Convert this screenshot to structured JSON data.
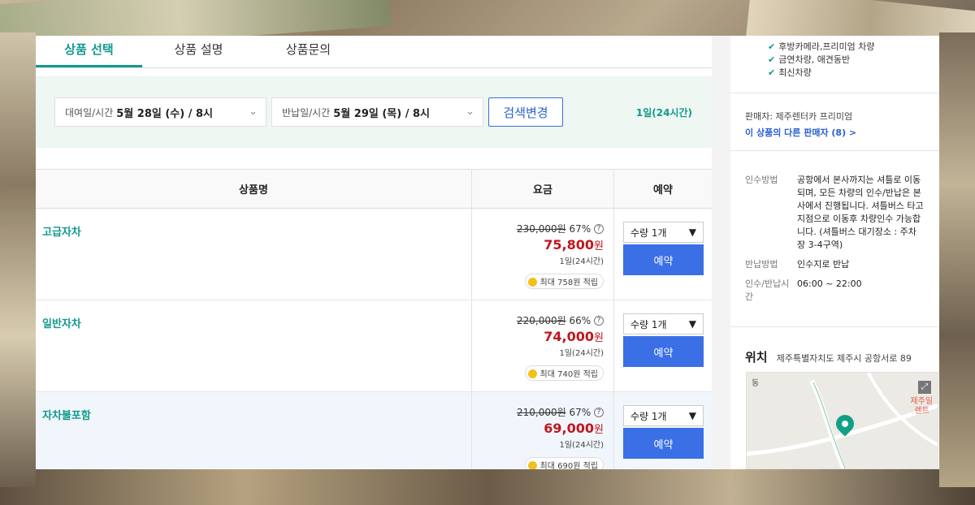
{
  "tabs": [
    "상품 선택",
    "상품 설명",
    "상품문의"
  ],
  "search": {
    "rental_label": "대여일/시간",
    "rental_value": "5월 28일 (수) / 8시",
    "return_label": "반납일/시간",
    "return_value": "5월 29일 (목) / 8시",
    "button": "검색변경",
    "duration": "1일(24시간)"
  },
  "table": {
    "headers": [
      "상품명",
      "요금",
      "예약"
    ],
    "rows": [
      {
        "name": "고급자차",
        "orig": "230,000원",
        "disc": "67%",
        "price": "75,800",
        "unit": "원",
        "per": "1일(24시간)",
        "points": "최대 758원 적립",
        "qty": "수량 1개",
        "reserve": "예약"
      },
      {
        "name": "일반자차",
        "orig": "220,000원",
        "disc": "66%",
        "price": "74,000",
        "unit": "원",
        "per": "1일(24시간)",
        "points": "최대 740원 적립",
        "qty": "수량 1개",
        "reserve": "예약"
      },
      {
        "name": "자차불포함",
        "orig": "210,000원",
        "disc": "67%",
        "price": "69,000",
        "unit": "원",
        "per": "1일(24시간)",
        "points": "최대 690원 적립",
        "qty": "수량 1개",
        "reserve": "예약"
      }
    ]
  },
  "side": {
    "features": [
      "후방카메라,프리미엄 차량",
      "금연차량, 애견동반",
      "최신차량"
    ],
    "seller": "판매자: 제주렌터카 프리미엄",
    "other_sellers": "이 상품의 다른 판매자 (8) >",
    "info": [
      {
        "k": "인수방법",
        "v": "공항에서 본사까지는 셔틀로 이동되며, 모든 차량의 인수/반납은 본사에서 진행됩니다. 셔틀버스 타고 지점으로 이동후 차량인수 가능합니다. (셔틀버스 대기장소 : 주차장 3-4구역)"
      },
      {
        "k": "반납방법",
        "v": "인수지로 반납"
      },
      {
        "k": "인수/반납시간",
        "v": "06:00 ~ 22:00"
      }
    ],
    "location_title": "위치",
    "location_addr": "제주특별자치도 제주시 공항서로 89",
    "map_labels": [
      "동",
      "제주일",
      "렌트"
    ]
  }
}
